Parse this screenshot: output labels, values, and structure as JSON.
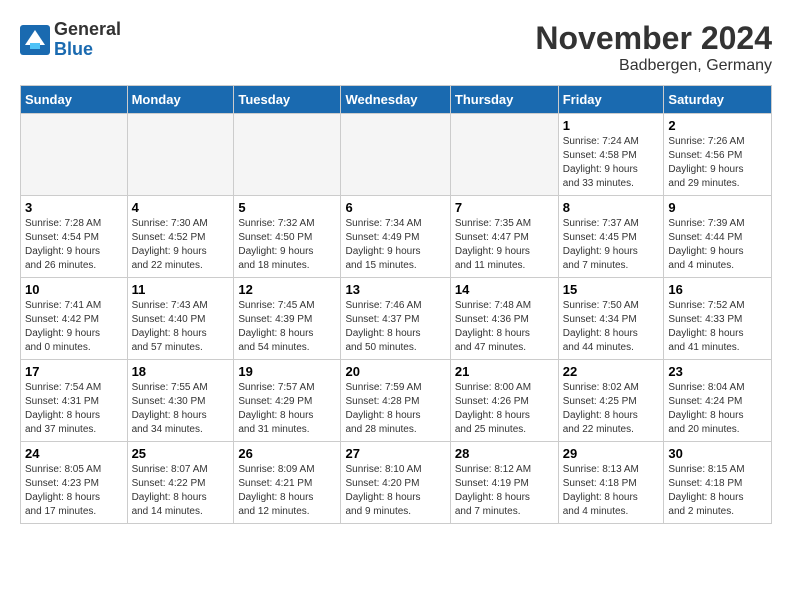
{
  "header": {
    "logo_general": "General",
    "logo_blue": "Blue",
    "title": "November 2024",
    "location": "Badbergen, Germany"
  },
  "weekdays": [
    "Sunday",
    "Monday",
    "Tuesday",
    "Wednesday",
    "Thursday",
    "Friday",
    "Saturday"
  ],
  "weeks": [
    [
      {
        "day": "",
        "info": ""
      },
      {
        "day": "",
        "info": ""
      },
      {
        "day": "",
        "info": ""
      },
      {
        "day": "",
        "info": ""
      },
      {
        "day": "",
        "info": ""
      },
      {
        "day": "1",
        "info": "Sunrise: 7:24 AM\nSunset: 4:58 PM\nDaylight: 9 hours\nand 33 minutes."
      },
      {
        "day": "2",
        "info": "Sunrise: 7:26 AM\nSunset: 4:56 PM\nDaylight: 9 hours\nand 29 minutes."
      }
    ],
    [
      {
        "day": "3",
        "info": "Sunrise: 7:28 AM\nSunset: 4:54 PM\nDaylight: 9 hours\nand 26 minutes."
      },
      {
        "day": "4",
        "info": "Sunrise: 7:30 AM\nSunset: 4:52 PM\nDaylight: 9 hours\nand 22 minutes."
      },
      {
        "day": "5",
        "info": "Sunrise: 7:32 AM\nSunset: 4:50 PM\nDaylight: 9 hours\nand 18 minutes."
      },
      {
        "day": "6",
        "info": "Sunrise: 7:34 AM\nSunset: 4:49 PM\nDaylight: 9 hours\nand 15 minutes."
      },
      {
        "day": "7",
        "info": "Sunrise: 7:35 AM\nSunset: 4:47 PM\nDaylight: 9 hours\nand 11 minutes."
      },
      {
        "day": "8",
        "info": "Sunrise: 7:37 AM\nSunset: 4:45 PM\nDaylight: 9 hours\nand 7 minutes."
      },
      {
        "day": "9",
        "info": "Sunrise: 7:39 AM\nSunset: 4:44 PM\nDaylight: 9 hours\nand 4 minutes."
      }
    ],
    [
      {
        "day": "10",
        "info": "Sunrise: 7:41 AM\nSunset: 4:42 PM\nDaylight: 9 hours\nand 0 minutes."
      },
      {
        "day": "11",
        "info": "Sunrise: 7:43 AM\nSunset: 4:40 PM\nDaylight: 8 hours\nand 57 minutes."
      },
      {
        "day": "12",
        "info": "Sunrise: 7:45 AM\nSunset: 4:39 PM\nDaylight: 8 hours\nand 54 minutes."
      },
      {
        "day": "13",
        "info": "Sunrise: 7:46 AM\nSunset: 4:37 PM\nDaylight: 8 hours\nand 50 minutes."
      },
      {
        "day": "14",
        "info": "Sunrise: 7:48 AM\nSunset: 4:36 PM\nDaylight: 8 hours\nand 47 minutes."
      },
      {
        "day": "15",
        "info": "Sunrise: 7:50 AM\nSunset: 4:34 PM\nDaylight: 8 hours\nand 44 minutes."
      },
      {
        "day": "16",
        "info": "Sunrise: 7:52 AM\nSunset: 4:33 PM\nDaylight: 8 hours\nand 41 minutes."
      }
    ],
    [
      {
        "day": "17",
        "info": "Sunrise: 7:54 AM\nSunset: 4:31 PM\nDaylight: 8 hours\nand 37 minutes."
      },
      {
        "day": "18",
        "info": "Sunrise: 7:55 AM\nSunset: 4:30 PM\nDaylight: 8 hours\nand 34 minutes."
      },
      {
        "day": "19",
        "info": "Sunrise: 7:57 AM\nSunset: 4:29 PM\nDaylight: 8 hours\nand 31 minutes."
      },
      {
        "day": "20",
        "info": "Sunrise: 7:59 AM\nSunset: 4:28 PM\nDaylight: 8 hours\nand 28 minutes."
      },
      {
        "day": "21",
        "info": "Sunrise: 8:00 AM\nSunset: 4:26 PM\nDaylight: 8 hours\nand 25 minutes."
      },
      {
        "day": "22",
        "info": "Sunrise: 8:02 AM\nSunset: 4:25 PM\nDaylight: 8 hours\nand 22 minutes."
      },
      {
        "day": "23",
        "info": "Sunrise: 8:04 AM\nSunset: 4:24 PM\nDaylight: 8 hours\nand 20 minutes."
      }
    ],
    [
      {
        "day": "24",
        "info": "Sunrise: 8:05 AM\nSunset: 4:23 PM\nDaylight: 8 hours\nand 17 minutes."
      },
      {
        "day": "25",
        "info": "Sunrise: 8:07 AM\nSunset: 4:22 PM\nDaylight: 8 hours\nand 14 minutes."
      },
      {
        "day": "26",
        "info": "Sunrise: 8:09 AM\nSunset: 4:21 PM\nDaylight: 8 hours\nand 12 minutes."
      },
      {
        "day": "27",
        "info": "Sunrise: 8:10 AM\nSunset: 4:20 PM\nDaylight: 8 hours\nand 9 minutes."
      },
      {
        "day": "28",
        "info": "Sunrise: 8:12 AM\nSunset: 4:19 PM\nDaylight: 8 hours\nand 7 minutes."
      },
      {
        "day": "29",
        "info": "Sunrise: 8:13 AM\nSunset: 4:18 PM\nDaylight: 8 hours\nand 4 minutes."
      },
      {
        "day": "30",
        "info": "Sunrise: 8:15 AM\nSunset: 4:18 PM\nDaylight: 8 hours\nand 2 minutes."
      }
    ]
  ]
}
